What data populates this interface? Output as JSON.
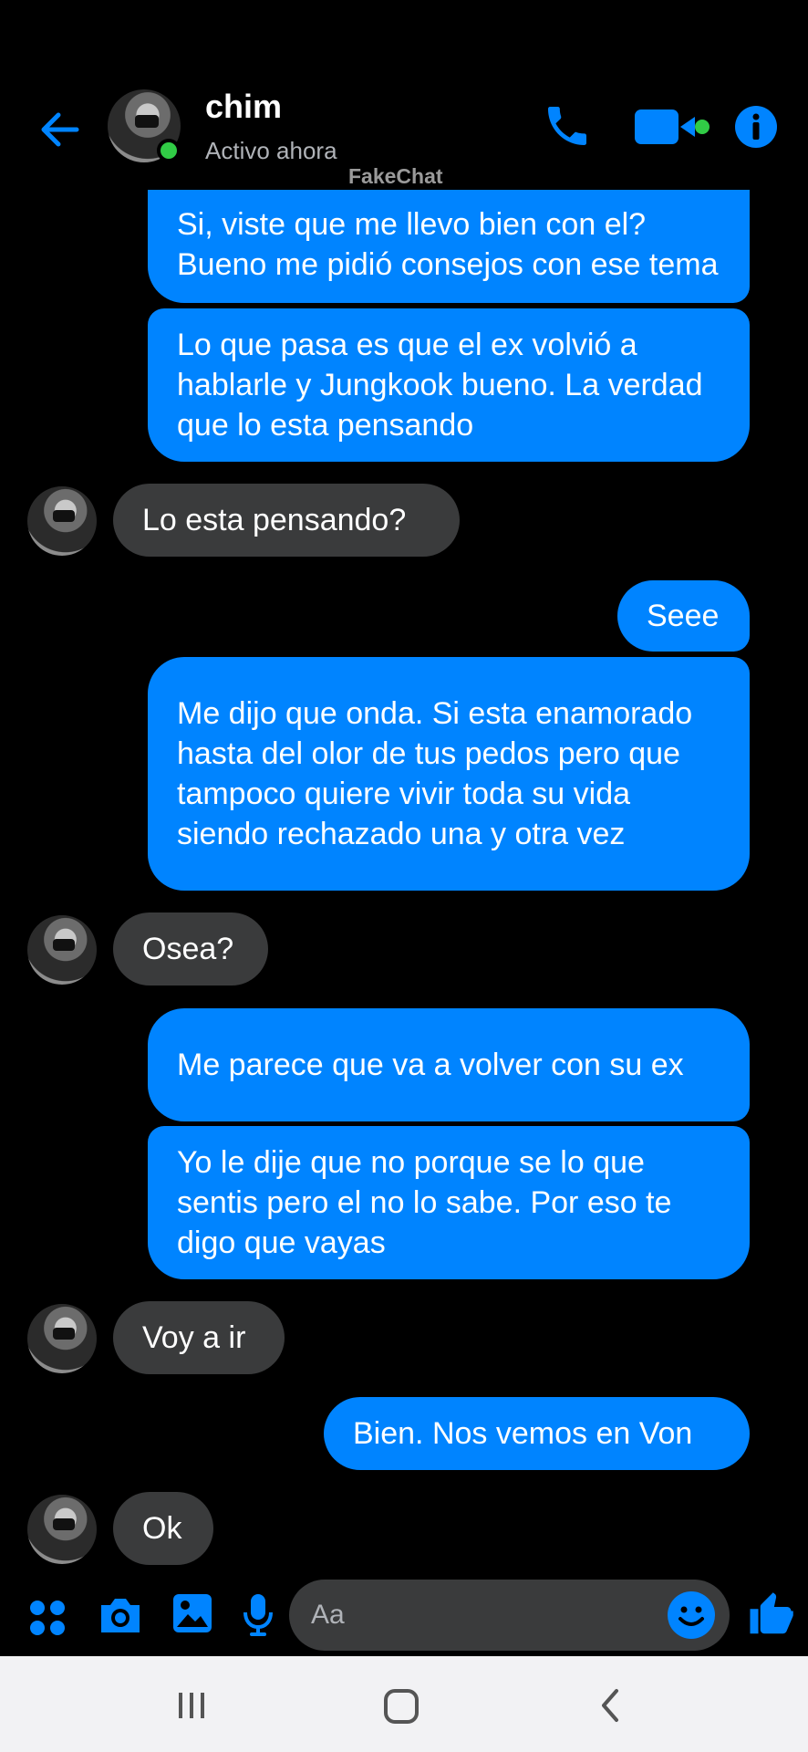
{
  "header": {
    "contact_name": "chim",
    "status": "Activo ahora",
    "watermark": "FakeChat",
    "icons": [
      "back-arrow-icon",
      "phone-icon",
      "video-camera-icon",
      "info-icon"
    ],
    "accent_color": "#0084ff",
    "online_color": "#31cc46"
  },
  "messages": [
    {
      "from": "me",
      "text": "Si, viste que me llevo bien con el? Bueno me pidió consejos con ese tema"
    },
    {
      "from": "me",
      "text": "Lo que pasa es que el ex volvió a hablarle y Jungkook bueno. La verdad que lo esta pensando"
    },
    {
      "from": "them",
      "text": "Lo esta pensando?"
    },
    {
      "from": "me",
      "text": "Seee"
    },
    {
      "from": "me",
      "text": "Me dijo que onda. Si esta enamorado hasta del olor de tus pedos pero que tampoco quiere vivir toda su vida siendo rechazado una y otra vez"
    },
    {
      "from": "them",
      "text": "Osea?"
    },
    {
      "from": "me",
      "text": "Me parece que va a volver con su ex"
    },
    {
      "from": "me",
      "text": "Yo le dije que no porque se lo que sentis pero el no lo sabe. Por eso te digo que vayas"
    },
    {
      "from": "them",
      "text": "Voy a ir"
    },
    {
      "from": "me",
      "text": "Bien. Nos vemos en Von"
    },
    {
      "from": "them",
      "text": "Ok"
    }
  ],
  "composer": {
    "placeholder": "Aa",
    "icons": [
      "apps-grid-icon",
      "camera-icon",
      "gallery-icon",
      "microphone-icon",
      "emoji-icon",
      "thumbs-up-icon"
    ]
  },
  "navbar": {
    "icons": [
      "recent-apps-icon",
      "home-icon",
      "back-icon"
    ],
    "background": "#f2f2f4"
  },
  "colors": {
    "outgoing_bubble": "#0084ff",
    "incoming_bubble": "#3a3b3c",
    "background": "#000000"
  }
}
